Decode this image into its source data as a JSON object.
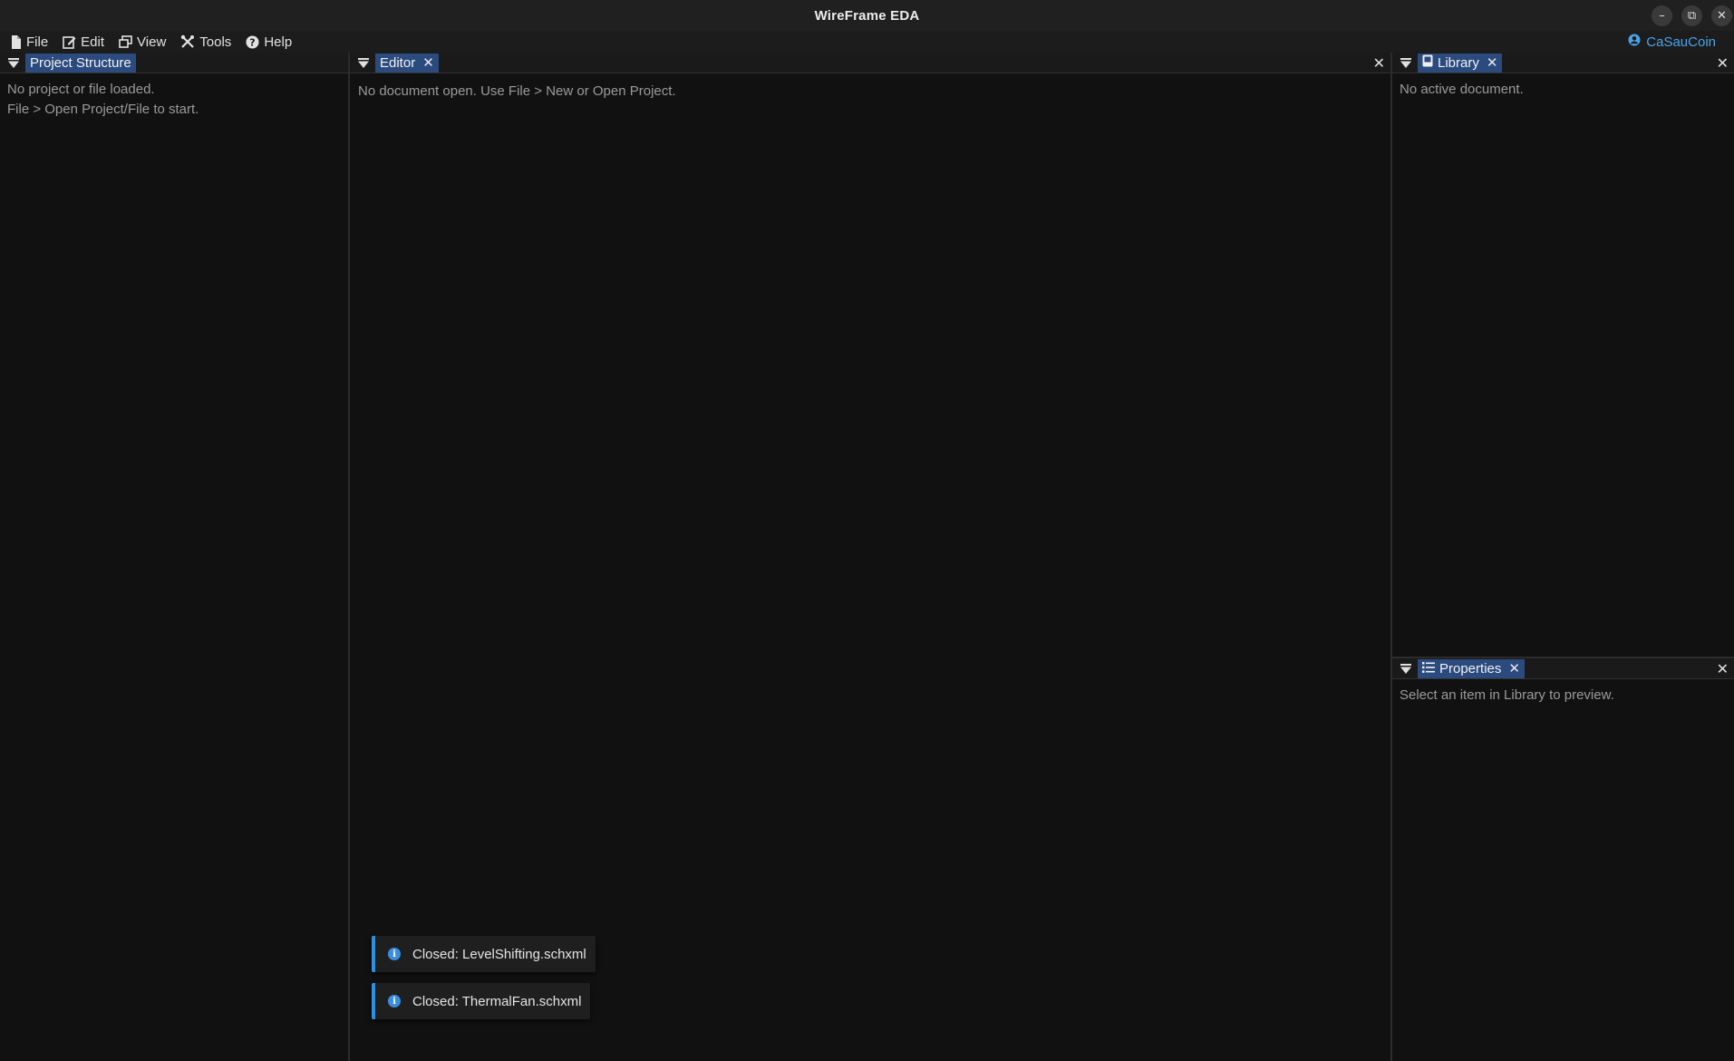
{
  "window": {
    "title": "WireFrame EDA",
    "controls": {
      "minimize": "–",
      "restore": "⧉",
      "close": "✕"
    }
  },
  "menubar": {
    "items": [
      {
        "label": "File",
        "icon": "file-icon"
      },
      {
        "label": "Edit",
        "icon": "edit-icon"
      },
      {
        "label": "View",
        "icon": "window-restore-icon"
      },
      {
        "label": "Tools",
        "icon": "tools-icon"
      },
      {
        "label": "Help",
        "icon": "help-circle-icon"
      }
    ],
    "user": {
      "name": "CaSauCoin",
      "icon": "user-circle-icon"
    }
  },
  "panels": {
    "project_structure": {
      "tab_label": "Project Structure",
      "lines": [
        "No project or file loaded.",
        "File > Open Project/File to start."
      ]
    },
    "editor": {
      "tab_label": "Editor",
      "close_symbol": "✕",
      "message": "No document open. Use File > New or Open Project."
    },
    "library": {
      "tab_label": "Library",
      "close_symbol": "✕",
      "message": "No active document."
    },
    "properties": {
      "tab_label": "Properties",
      "close_symbol": "✕",
      "message": "Select an item in Library to preview."
    }
  },
  "toasts": [
    {
      "text": "Closed: LevelShifting.schxml",
      "icon": "info-icon",
      "symbol": "i"
    },
    {
      "text": "Closed: ThermalFan.schxml",
      "icon": "info-icon",
      "symbol": "i"
    }
  ],
  "colors": {
    "background": "#111111",
    "tab_active": "#2b4a7e",
    "accent": "#4aa3ea",
    "toast_border": "#2f8fe0"
  }
}
